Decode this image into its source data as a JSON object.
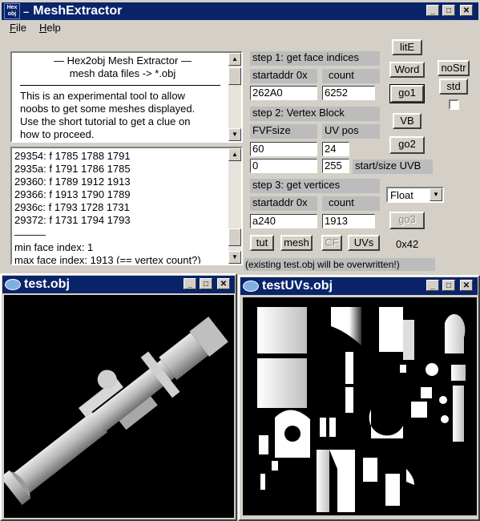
{
  "main_window": {
    "title": "MeshExtractor",
    "app_icon_text_top": "Hex",
    "app_icon_text_bottom": "obj",
    "menu": [
      "File",
      "Help"
    ]
  },
  "info_text": {
    "heading1": "—  Hex2obj Mesh Extractor  —",
    "heading2": "mesh data files -> *.obj",
    "body": [
      "This is an experimental tool to allow",
      "noobs to get some meshes displayed.",
      "Use the short tutorial to get a clue on",
      "how to proceed."
    ]
  },
  "log": {
    "lines": [
      "29354: f  1785 1788 1791",
      "2935a: f  1791 1786 1785",
      "29360: f  1789 1912 1913",
      "29366: f  1913 1790 1789",
      "2936c: f  1793 1728 1731",
      "29372: f  1731 1794 1793"
    ],
    "separator": "———",
    "min_line": "min face index: 1",
    "max_line": "max face index: 1913 (== vertex count?)"
  },
  "step1": {
    "title": "step 1: get face indices",
    "startaddr_label": "startaddr 0x",
    "count_label": "count",
    "startaddr": "262A0",
    "count": "6252"
  },
  "step2": {
    "title": "step 2: Vertex Block",
    "fvf_label": "FVFsize",
    "uvpos_label": "UV pos",
    "fvf": "60",
    "uvpos": "24",
    "start": "0",
    "size": "255",
    "startsize_label": "start/size UVB"
  },
  "step3": {
    "title": "step 3: get vertices",
    "startaddr_label": "startaddr 0x",
    "count_label": "count",
    "startaddr": "a240",
    "count": "1913"
  },
  "buttons": {
    "lite": "litE",
    "word": "Word",
    "go1": "go1",
    "nostr": "noStr",
    "std": "std",
    "vb": "VB",
    "go2": "go2",
    "go3": "go3",
    "tut": "tut",
    "mesh": "mesh",
    "cf": "CF",
    "uvs": "UVs"
  },
  "float_select": "Float",
  "hex_readout": "0x42",
  "warning": "(existing test.obj will be overwritten!)",
  "child1": {
    "title": "test.obj"
  },
  "child2": {
    "title": "testUVs.obj"
  },
  "colors": {
    "titlebar": "#0a246a",
    "face": "#d4d0c8",
    "label_bg": "#bcbcbc"
  }
}
